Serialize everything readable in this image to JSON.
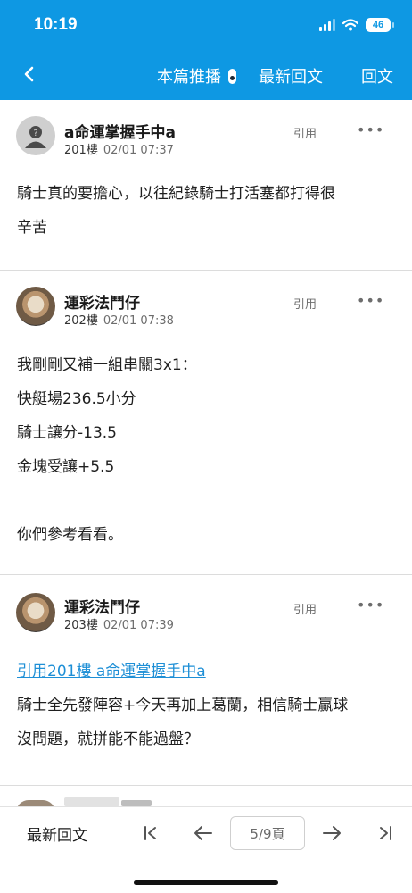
{
  "status_bar": {
    "time": "10:19",
    "battery": "46"
  },
  "nav": {
    "push_label": "本篇推播",
    "latest_label": "最新回文",
    "reply_label": "回文"
  },
  "posts": [
    {
      "username": "a命運掌握手中a",
      "floor": "201樓",
      "datetime": "02/01 07:37",
      "quote_label": "引用",
      "more": "•••",
      "lines": [
        "騎士真的要擔心，以往紀錄騎士打活塞都打得很",
        "辛苦"
      ]
    },
    {
      "username": "運彩法鬥仔",
      "floor": "202樓",
      "datetime": "02/01 07:38",
      "quote_label": "引用",
      "more": "•••",
      "lines": [
        "我剛剛又補一組串關3x1：",
        "快艇場236.5小分",
        "騎士讓分-13.5",
        "金塊受讓+5.5",
        "",
        "你們參考看看。"
      ]
    },
    {
      "username": "運彩法鬥仔",
      "floor": "203樓",
      "datetime": "02/01 07:39",
      "quote_label": "引用",
      "more": "•••",
      "quote_link": "引用201樓 a命運掌握手中a",
      "lines": [
        "騎士全先發陣容+今天再加上葛蘭，相信騎士贏球",
        "沒問題，就拼能不能過盤？"
      ]
    }
  ],
  "footer": {
    "latest_label": "最新回文",
    "page_indicator": "5/9頁"
  }
}
